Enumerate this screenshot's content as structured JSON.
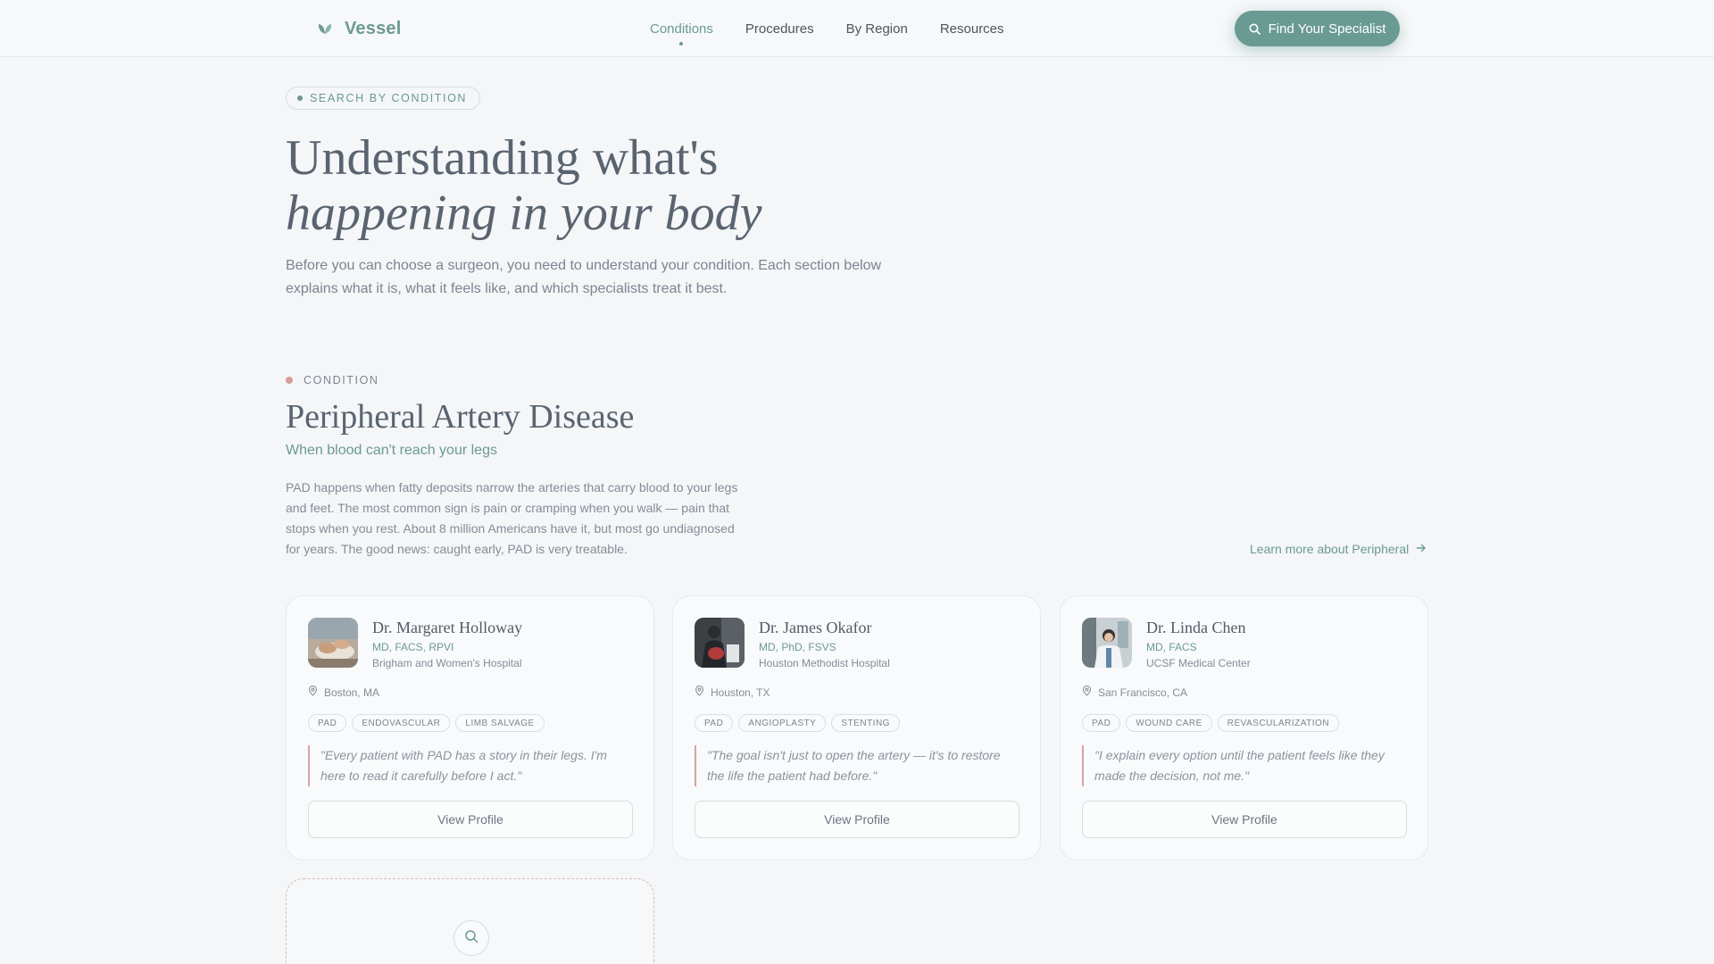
{
  "nav": {
    "brand": "Vessel",
    "links": [
      {
        "label": "Conditions",
        "active": true
      },
      {
        "label": "Procedures",
        "active": false
      },
      {
        "label": "By Region",
        "active": false
      },
      {
        "label": "Resources",
        "active": false
      }
    ],
    "cta_label": "Find Your Specialist"
  },
  "hero": {
    "pill": "SEARCH BY CONDITION",
    "title_line1": "Understanding what's",
    "title_line2": "happening in your body",
    "lead": "Before you can choose a surgeon, you need to understand your condition. Each section below explains what it is, what it feels like, and which specialists treat it best."
  },
  "condition": {
    "label": "CONDITION",
    "title": "Peripheral Artery Disease",
    "subtitle": "When blood can't reach your legs",
    "description": "PAD happens when fatty deposits narrow the arteries that carry blood to your legs and feet. The most common sign is pain or cramping when you walk — pain that stops when you rest. About 8 million Americans have it, but most go undiagnosed for years. The good news: caught early, PAD is very treatable.",
    "learn_more": "Learn more about Peripheral"
  },
  "doctors": [
    {
      "name": "Dr. Margaret Holloway",
      "credentials": "MD, FACS, RPVI",
      "hospital": "Brigham and Women's Hospital",
      "location": "Boston, MA",
      "tags": [
        "PAD",
        "ENDOVASCULAR",
        "LIMB SALVAGE"
      ],
      "quote": "\"Every patient with PAD has a story in their legs. I'm here to read it carefully before I act.\"",
      "button": "View Profile"
    },
    {
      "name": "Dr. James Okafor",
      "credentials": "MD, PhD, FSVS",
      "hospital": "Houston Methodist Hospital",
      "location": "Houston, TX",
      "tags": [
        "PAD",
        "ANGIOPLASTY",
        "STENTING"
      ],
      "quote": "\"The goal isn't just to open the artery — it's to restore the life the patient had before.\"",
      "button": "View Profile"
    },
    {
      "name": "Dr. Linda Chen",
      "credentials": "MD, FACS",
      "hospital": "UCSF Medical Center",
      "location": "San Francisco, CA",
      "tags": [
        "PAD",
        "WOUND CARE",
        "REVASCULARIZATION"
      ],
      "quote": "\"I explain every option until the patient feels like they made the decision, not me.\"",
      "button": "View Profile"
    }
  ],
  "colors": {
    "accent": "#6b9a92",
    "rose": "#d99a9a",
    "background": "#f4f6f8"
  }
}
